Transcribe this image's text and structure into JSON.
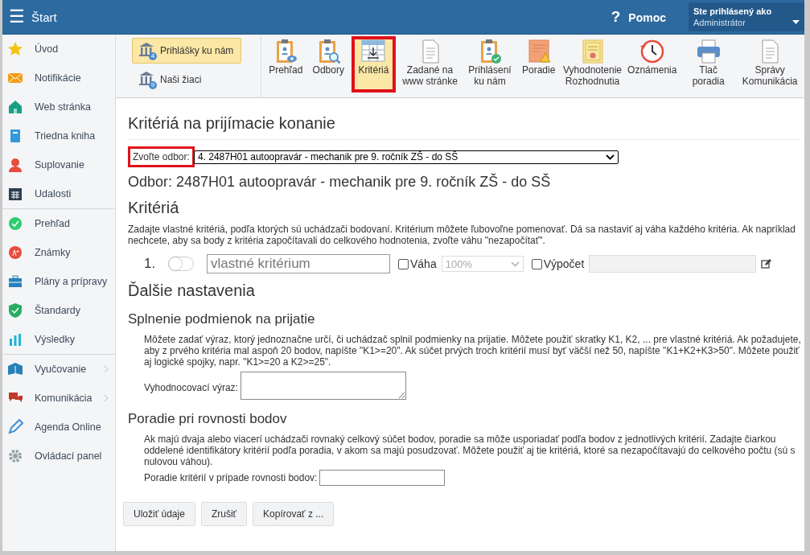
{
  "topbar": {
    "menu_glyph": "☰",
    "title": "Štart",
    "help_glyph": "?",
    "help": "Pomoc",
    "user_label": "Ste prihlásený ako",
    "user": "Administrátor"
  },
  "sidebar": {
    "sections": [
      [
        {
          "label": "Úvod",
          "kind": "star",
          "submenu": false
        },
        {
          "label": "Notifikácie",
          "kind": "mail",
          "submenu": false
        },
        {
          "label": "Web stránka",
          "kind": "house",
          "submenu": false
        },
        {
          "label": "Triedna kniha",
          "kind": "book",
          "submenu": false
        },
        {
          "label": "Suplovanie",
          "kind": "person",
          "submenu": false
        },
        {
          "label": "Udalosti",
          "kind": "calendar",
          "submenu": false
        }
      ],
      [
        {
          "label": "Prehľad",
          "kind": "check",
          "submenu": false
        },
        {
          "label": "Známky",
          "kind": "grade",
          "submenu": false
        },
        {
          "label": "Plány a prípravy",
          "kind": "briefcase",
          "submenu": false
        },
        {
          "label": "Štandardy",
          "kind": "shield",
          "submenu": false
        },
        {
          "label": "Výsledky",
          "kind": "bars",
          "submenu": false
        }
      ],
      [
        {
          "label": "Vyučovanie",
          "kind": "openbook",
          "submenu": true
        },
        {
          "label": "Komunikácia",
          "kind": "chat",
          "submenu": true
        },
        {
          "label": "Agenda Online",
          "kind": "pen",
          "submenu": false
        },
        {
          "label": "Ovládací panel",
          "kind": "gear",
          "submenu": false
        }
      ]
    ]
  },
  "toolbar": {
    "groups": [
      {
        "label": "Prihlášky ku nám",
        "badge": "4",
        "selected": true
      },
      {
        "label": "Naši žiaci",
        "badge": "9",
        "selected": false
      }
    ],
    "tools": [
      {
        "label": "Prehľad",
        "kind": "clipboard-eye",
        "selected": false,
        "highlighted": false
      },
      {
        "label": "Odbory",
        "kind": "clipboard-search",
        "selected": false,
        "highlighted": false
      },
      {
        "label": "Kritériá",
        "kind": "table",
        "selected": true,
        "highlighted": true
      },
      {
        "label": "Zadané na www stránke",
        "kind": "document",
        "selected": false,
        "highlighted": false
      },
      {
        "label": "Prihlásení ku nám",
        "kind": "clipboard-check",
        "selected": false,
        "highlighted": false
      },
      {
        "label": "Poradie",
        "kind": "warning-doc",
        "selected": false,
        "highlighted": false
      },
      {
        "label": "Vyhodnotenie Rozhodnutia",
        "kind": "certificate",
        "selected": false,
        "highlighted": false
      },
      {
        "label": "Oznámenia",
        "kind": "clock",
        "selected": false,
        "highlighted": false
      },
      {
        "label": "Tlač poradia",
        "kind": "printer",
        "selected": false,
        "highlighted": false
      },
      {
        "label": "Správy Komunikácia",
        "kind": "document",
        "selected": false,
        "highlighted": false
      }
    ]
  },
  "page": {
    "title": "Kritériá na prijímacie konanie",
    "program_select": {
      "label": "Zvoľte odbor:",
      "value": "4. 2487H01 autoopravár - mechanik pre 9. ročník ZŠ - do SŠ",
      "highlighted": true
    },
    "program_heading": "Odbor: 2487H01 autoopravár - mechanik pre 9. ročník ZŠ - do SŠ",
    "criteria_heading": "Kritériá",
    "criteria_text": "Zadajte vlastné kritériá, podľa ktorých sú uchádzači bodovaní. Kritérium môžete ľubovoľne pomenovať. Dá sa nastaviť aj váha každého kritéria. Ak napríklad nechcete, aby sa body z kritéria započítavali do celkového hodnotenia, zvoľte váhu \"nezapočítať\".",
    "criteria": [
      {
        "number": "1.",
        "on": false,
        "placeholder": "vlastné kritérium",
        "weight_label": "Váha",
        "weight_checked": false,
        "weight": "100%",
        "calc_label": "Výpočet",
        "calc_checked": false
      }
    ],
    "more_heading": "Ďalšie nastavenia",
    "conditions": {
      "heading": "Splnenie podmienok na prijatie",
      "text": "Môžete zadať výraz, ktorý jednoznačne určí, či uchádzač splnil podmienky na prijatie. Môžete použiť skratky K1, K2, ... pre vlastné kritériá. Ak požadujete, aby z prvého kritéria mal aspoň 20 bodov, napíšte \"K1>=20\". Ak súčet prvých troch kritérií musí byť väčší než 50, napíšte \"K1+K2+K3>50\". Môžete použiť aj logické spojky, napr. \"K1>=20 a K2>=25\".",
      "field_label": "Vyhodnocovací výraz:"
    },
    "tie": {
      "heading": "Poradie pri rovnosti bodov",
      "text": "Ak majú dvaja alebo viacerí uchádzači rovnaký celkový súčet bodov, poradie sa môže usporiadať podľa bodov z jednotlivých kritérií. Zadajte čiarkou oddelené identifikátory kritérií podľa poradia, v akom sa majú posudzovať. Môžete použiť aj tie kritériá, ktoré sa nezapočítavajú do celkového počtu (sú s nulovou váhou).",
      "field_label": "Poradie kritérií v prípade rovnosti bodov:"
    },
    "buttons": [
      "Uložiť údaje",
      "Zrušiť",
      "Kopírovať z ..."
    ]
  }
}
